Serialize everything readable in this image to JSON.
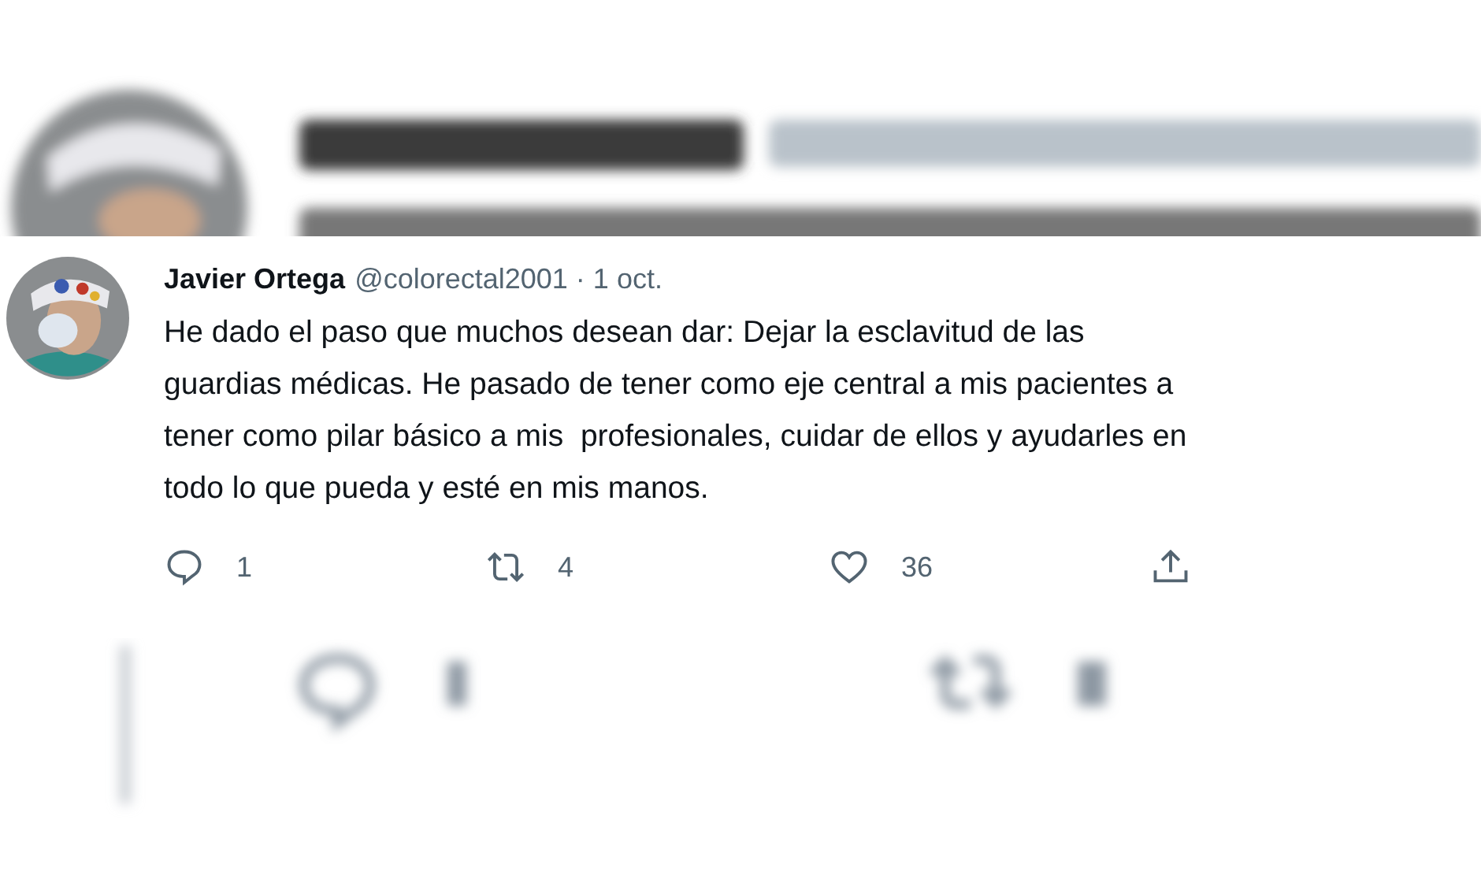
{
  "tweet": {
    "author": {
      "name": "Javier Ortega",
      "meta": "@colorectal2001 · 1 oct."
    },
    "text_lines": [
      "He dado el paso que muchos desean dar: Dejar la esclavitud de las",
      "guardias médicas. He pasado de tener como eje central a mis pacientes a",
      "tener como pilar básico a mis  profesionales, cuidar de ellos y ayudarles en",
      "todo lo que pueda y esté en mis manos."
    ],
    "actions": [
      {
        "kind": "reply",
        "count": "1"
      },
      {
        "kind": "retweet",
        "count": "4"
      },
      {
        "kind": "like",
        "count": "36"
      },
      {
        "kind": "share"
      }
    ]
  }
}
